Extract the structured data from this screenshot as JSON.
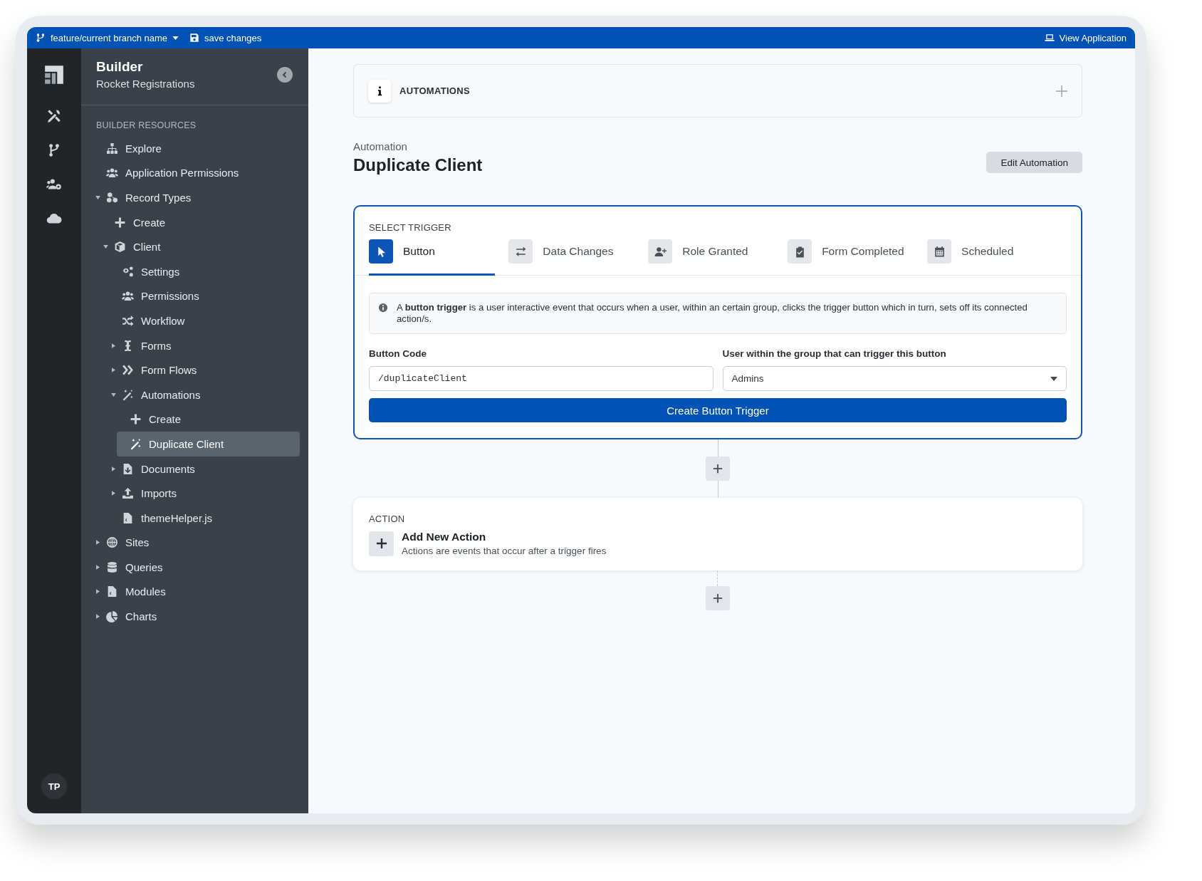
{
  "top_bar": {
    "branch": "feature/current branch name",
    "save": "save changes",
    "view_app": "View Application"
  },
  "rail": {
    "avatar": "TP"
  },
  "sidebar": {
    "title": "Builder",
    "subtitle": "Rocket Registrations",
    "section": "BUILDER RESOURCES",
    "items": [
      {
        "label": "Explore",
        "selected": false
      },
      {
        "label": "Application Permissions",
        "selected": false
      },
      {
        "label": "Record Types",
        "selected": false,
        "expanded": true,
        "children": [
          {
            "label": "Create",
            "selected": false
          },
          {
            "label": "Client",
            "selected": false,
            "expanded": true,
            "children": [
              {
                "label": "Settings",
                "selected": false
              },
              {
                "label": "Permissions",
                "selected": false
              },
              {
                "label": "Workflow",
                "selected": false
              },
              {
                "label": "Forms",
                "selected": false,
                "expanded": false
              },
              {
                "label": "Form Flows",
                "selected": false,
                "expanded": false
              },
              {
                "label": "Automations",
                "selected": false,
                "expanded": true,
                "children": [
                  {
                    "label": "Create",
                    "selected": false
                  },
                  {
                    "label": "Duplicate Client",
                    "selected": true
                  }
                ]
              },
              {
                "label": "Documents",
                "selected": false,
                "expanded": false
              },
              {
                "label": "Imports",
                "selected": false,
                "expanded": false
              },
              {
                "label": "themeHelper.js",
                "selected": false
              }
            ]
          }
        ]
      },
      {
        "label": "Sites",
        "selected": false,
        "expanded": false
      },
      {
        "label": "Queries",
        "selected": false,
        "expanded": false
      },
      {
        "label": "Modules",
        "selected": false,
        "expanded": false
      },
      {
        "label": "Charts",
        "selected": false,
        "expanded": false
      }
    ]
  },
  "main": {
    "section_bar": "AUTOMATIONS",
    "eyebrow": "Automation",
    "title": "Duplicate Client",
    "edit_button": "Edit Automation",
    "trigger": {
      "heading": "SELECT TRIGGER",
      "tabs": [
        {
          "label": "Button",
          "selected": true
        },
        {
          "label": "Data Changes",
          "selected": false
        },
        {
          "label": "Role Granted",
          "selected": false
        },
        {
          "label": "Form Completed",
          "selected": false
        },
        {
          "label": "Scheduled",
          "selected": false
        }
      ],
      "info": "A **button trigger** is a user interactive event that occurs when a user, within an certain group, clicks the trigger button which in turn, sets off its connected action/s.",
      "code_label": "Button Code",
      "code_value": "/duplicateClient",
      "group_label": "User within the group that can trigger this button",
      "group_value": "Admins",
      "submit": "Create Button Trigger"
    },
    "action": {
      "heading": "ACTION",
      "title": "Add New Action",
      "subtitle": "Actions are events that occur after a trigger fires"
    }
  }
}
